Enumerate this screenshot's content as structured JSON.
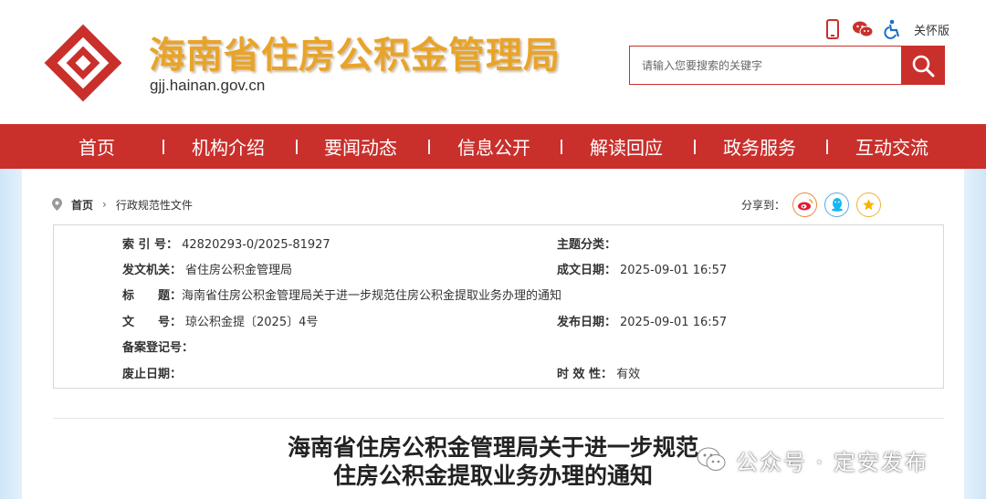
{
  "header": {
    "site_title": "海南省住房公积金管理局",
    "site_url": "gjj.hainan.gov.cn",
    "care_version_label": "关怀版",
    "search_placeholder": "请输入您要搜索的关键字"
  },
  "nav": {
    "items": [
      "首页",
      "机构介绍",
      "要闻动态",
      "信息公开",
      "解读回应",
      "政务服务",
      "互动交流"
    ]
  },
  "breadcrumb": {
    "home": "首页",
    "current": "行政规范性文件"
  },
  "share": {
    "label": "分享到："
  },
  "meta": {
    "index_label": "索 引 号：",
    "index_value": "42820293-0/2025-81927",
    "topic_label": "主题分类：",
    "topic_value": "",
    "issuer_label": "发文机关：",
    "issuer_value": "省住房公积金管理局",
    "created_label": "成文日期：",
    "created_value": "2025-09-01 16:57",
    "title_label": "标　　题：",
    "title_value": "海南省住房公积金管理局关于进一步规范住房公积金提取业务办理的通知",
    "docno_label": "文　　号：",
    "docno_value": "琼公积金提〔2025〕4号",
    "published_label": "发布日期：",
    "published_value": "2025-09-01 16:57",
    "record_label": "备案登记号：",
    "record_value": "",
    "abolish_label": "废止日期：",
    "abolish_value": "",
    "validity_label": "时 效 性：",
    "validity_value": "有效"
  },
  "document": {
    "title_line1": "海南省住房公积金管理局关于进一步规范",
    "title_line2": "住房公积金提取业务办理的通知"
  },
  "watermark": {
    "text": "公众号 · 定安发布"
  },
  "colors": {
    "brand_red": "#c9302c",
    "title_gold": "#e8a42a"
  }
}
